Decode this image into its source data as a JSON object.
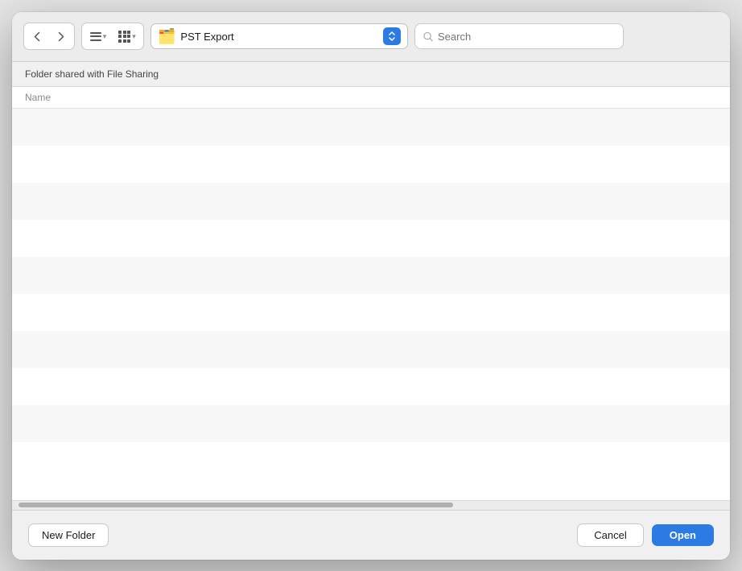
{
  "toolbar": {
    "back_button_label": "‹",
    "forward_button_label": "›",
    "location": "PST Export",
    "search_placeholder": "Search"
  },
  "content": {
    "shared_banner": "Folder shared with File Sharing",
    "column_name": "Name"
  },
  "file_rows": [
    {},
    {},
    {},
    {},
    {},
    {},
    {},
    {},
    {},
    {}
  ],
  "bottom_bar": {
    "new_folder_label": "New Folder",
    "cancel_label": "Cancel",
    "open_label": "Open"
  }
}
